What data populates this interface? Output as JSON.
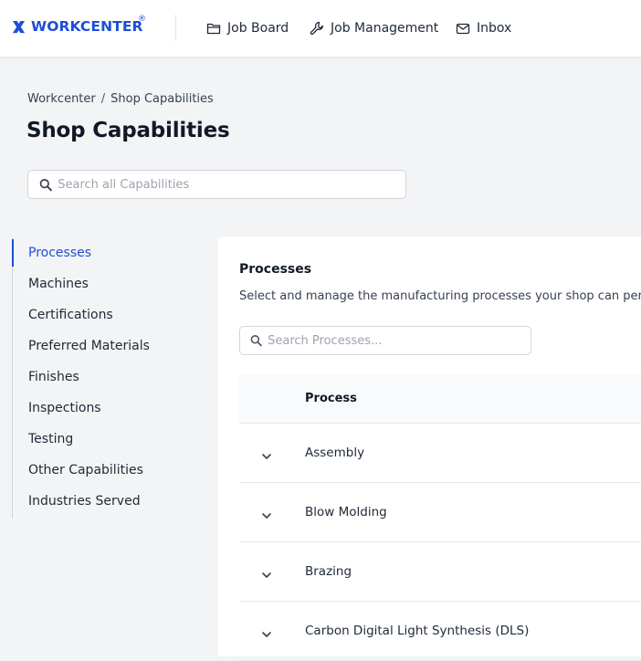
{
  "colors": {
    "accent": "#1d4ed8",
    "background": "#f3f4f6",
    "card": "#ffffff",
    "border": "#d1d5db"
  },
  "header": {
    "brand": "WORKCENTER",
    "brand_reg": "®",
    "brand_icon": "x-logo-icon",
    "nav": [
      {
        "label": "Job Board",
        "icon": "folder-icon"
      },
      {
        "label": "Job Management",
        "icon": "wrench-icon"
      },
      {
        "label": "Inbox",
        "icon": "envelope-icon"
      }
    ]
  },
  "breadcrumb": {
    "root": "Workcenter",
    "separator": "/",
    "current": "Shop Capabilities"
  },
  "page": {
    "title": "Shop Capabilities",
    "search_placeholder": "Search all Capabilities"
  },
  "sidebar": {
    "active": "Processes",
    "items": [
      {
        "label": "Processes"
      },
      {
        "label": "Machines"
      },
      {
        "label": "Certifications"
      },
      {
        "label": "Preferred Materials"
      },
      {
        "label": "Finishes"
      },
      {
        "label": "Inspections"
      },
      {
        "label": "Testing"
      },
      {
        "label": "Other Capabilities"
      },
      {
        "label": "Industries Served"
      }
    ]
  },
  "panel": {
    "title": "Processes",
    "description": "Select and manage the manufacturing processes your shop can per",
    "search_placeholder": "Search Processes...",
    "table": {
      "column_header": "Process",
      "rows": [
        {
          "name": "Assembly"
        },
        {
          "name": "Blow Molding"
        },
        {
          "name": "Brazing"
        },
        {
          "name": "Carbon Digital Light Synthesis (DLS)"
        }
      ]
    }
  }
}
